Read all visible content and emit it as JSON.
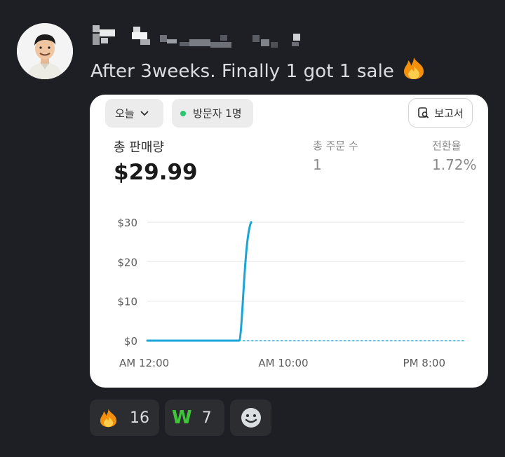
{
  "message": {
    "text": "After 3weeks. Finally 1 got 1 sale"
  },
  "card": {
    "date_filter": "오늘",
    "visitors_label": "방문자 1명",
    "report_button": "보고서",
    "total_sales_label": "총 판매량",
    "total_sales_value": "$29.99",
    "orders_label": "총 주문 수",
    "orders_value": "1",
    "conversion_label": "전환율",
    "conversion_value": "1.72%"
  },
  "chart_data": {
    "type": "line",
    "x_ticks": [
      "AM 12:00",
      "AM 10:00",
      "PM 8:00"
    ],
    "y_ticks": [
      "$0",
      "$10",
      "$20",
      "$30"
    ],
    "ylim": [
      0,
      30
    ],
    "series": [
      {
        "line_style": "solid",
        "color": "#1ba4d6",
        "points": [
          {
            "x": 0,
            "y": 0
          },
          {
            "x": 6.8,
            "y": 0
          },
          {
            "x": 7.7,
            "y": 30
          }
        ]
      },
      {
        "line_style": "dotted",
        "color": "#1ba4d6",
        "points": [
          {
            "x": 6.8,
            "y": 0
          },
          {
            "x": 23.5,
            "y": 0
          }
        ]
      }
    ],
    "x_hours_domain": [
      0,
      23.5
    ]
  },
  "reactions": [
    {
      "icon": "fire-emoji-icon",
      "count": "16"
    },
    {
      "icon": "w-emoji-icon",
      "label": "W",
      "count": "7"
    }
  ],
  "colors": {
    "background": "#1e1f24",
    "accent_line": "#1ba4d6",
    "visitor_dot": "#29c76f"
  }
}
